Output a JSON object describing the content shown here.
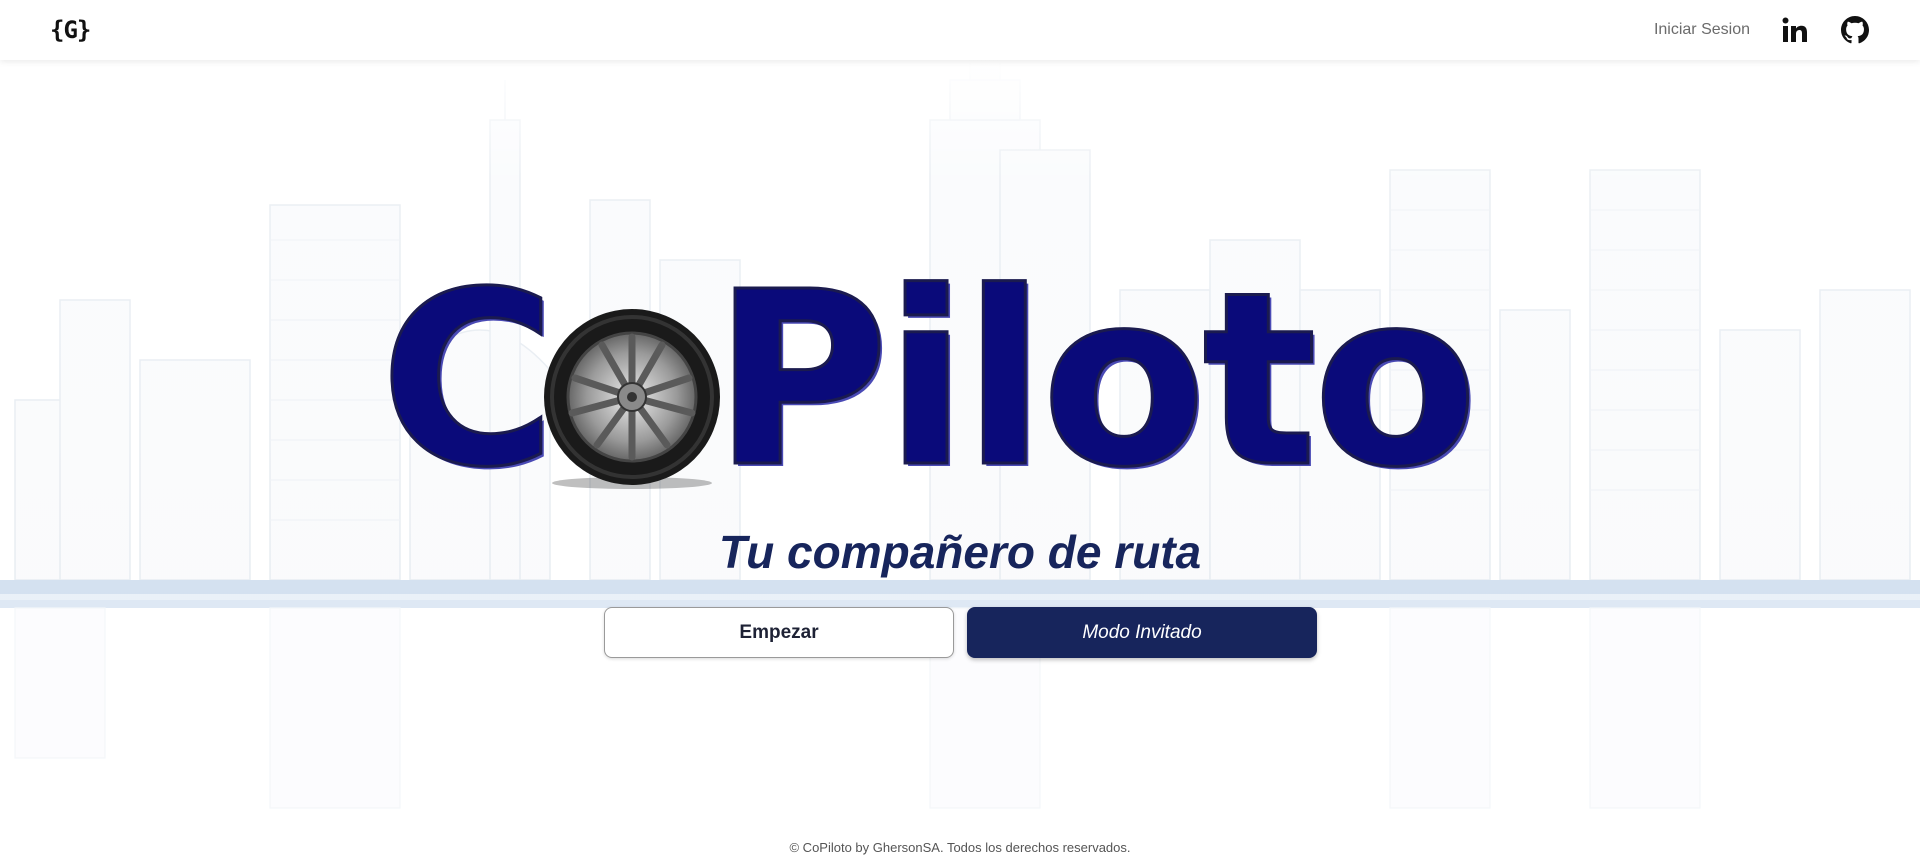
{
  "header": {
    "brand": "{G}",
    "login_label": "Iniciar Sesion",
    "icons": [
      "linkedin-icon",
      "github-icon"
    ]
  },
  "hero": {
    "logo_text": "CoPiloto",
    "tagline": "Tu compañero de ruta",
    "primary_button": "Empezar",
    "secondary_button": "Modo Invitado"
  },
  "footer": {
    "text": "© CoPiloto by GhersonSA. Todos los derechos reservados."
  },
  "colors": {
    "brand_dark": "#17255c",
    "logo_blue": "#0a0a7a",
    "accent_light": "#b8cde6"
  }
}
